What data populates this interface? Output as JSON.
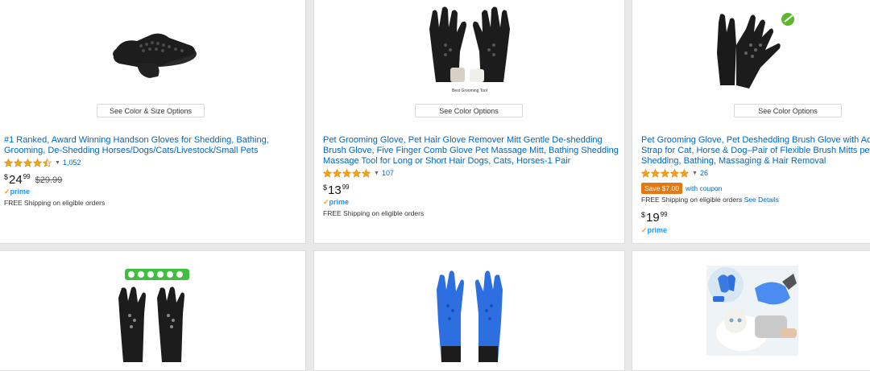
{
  "colors": {
    "link": "#0066c0",
    "star": "#f4a417",
    "prime": "#1a98ff",
    "coupon": "#e47911"
  },
  "products": [
    {
      "image_icon": "black-rubber-glove-icon",
      "options_label": "See Color & Size Options",
      "title_lines": [
        "#1 Ranked, Award Winning Handson Gloves for Shedding, Bathing,",
        "Grooming, De-Shedding Horses/Dogs/Cats/Livestock/Small Pets"
      ],
      "rating": 4.5,
      "review_count": "1,052",
      "price_currency": "$",
      "price_whole": "24",
      "price_fraction": "99",
      "list_price": "$29.99",
      "prime": "prime",
      "shipping": "FREE Shipping on eligible orders"
    },
    {
      "image_icon": "pet-grooming-glove-pair-icon",
      "image_caption": "Best Grooming Tool",
      "options_label": "See Color Options",
      "title_lines": [
        "Pet Grooming Glove, Pet Hair Glove Remover Mitt Gentle De-shedding",
        "Brush Glove, Five Finger Comb Glove Pet Massage Mitt, Bathing Shedding",
        "Massage Tool for Long or Short Hair Dogs, Cats, Horses-1 Pair"
      ],
      "rating": 5,
      "review_count": "107",
      "price_currency": "$",
      "price_whole": "13",
      "price_fraction": "99",
      "prime": "prime",
      "shipping": "FREE Shipping on eligible orders"
    },
    {
      "image_icon": "deshedding-glove-pair-icon",
      "options_label": "See Color Options",
      "title_lines": [
        "Pet Grooming Glove, Pet Deshedding Brush Glove with Adj",
        "Strap for Cat, Horse & Dog–Pair of Flexible Brush Mitts pet",
        "Shedding, Bathing, Massaging & Hair Removal"
      ],
      "rating": 5,
      "review_count": "26",
      "coupon_badge": "Save $7.00",
      "coupon_text": "with coupon",
      "shipping": "FREE Shipping on eligible orders",
      "shipping_link": "See Details",
      "price_currency": "$",
      "price_whole": "19",
      "price_fraction": "99",
      "prime": "prime"
    },
    {
      "image_icon": "grooming-gloves-with-icons-icon"
    },
    {
      "image_icon": "blue-grooming-gloves-icon"
    },
    {
      "image_icon": "blue-glove-cat-photo-icon"
    }
  ]
}
